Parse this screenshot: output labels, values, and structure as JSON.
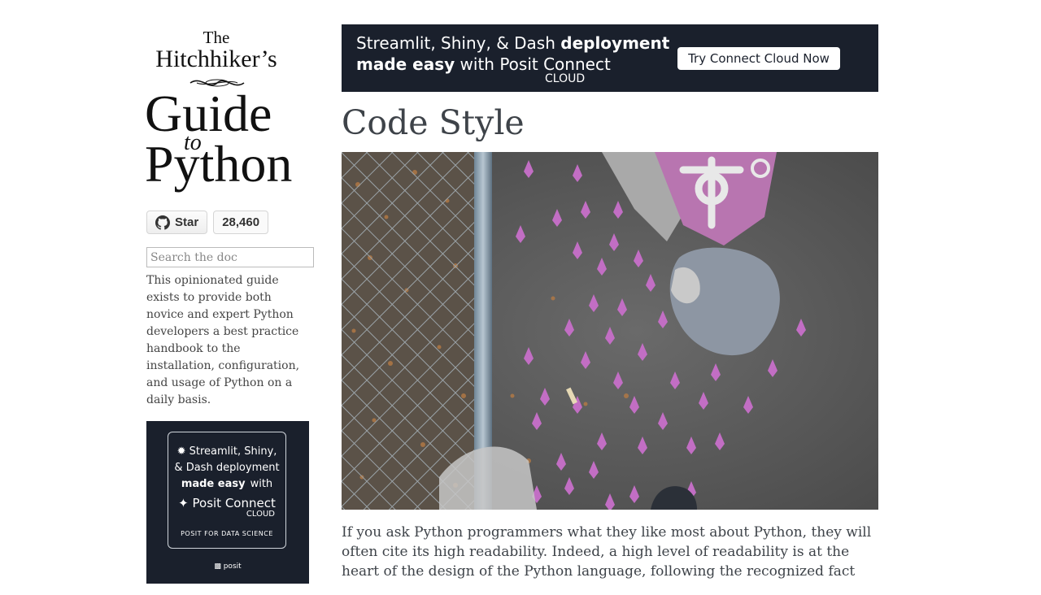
{
  "logo": {
    "the": "The",
    "hitchhikers": "Hitchhiker’s",
    "guide": "Guide",
    "to": "to",
    "python": "Python"
  },
  "github": {
    "star_label": "Star",
    "count": "28,460",
    "icon": "github-icon"
  },
  "search": {
    "placeholder": "Search the doc"
  },
  "sidebar_description": "This opinionated guide exists to provide both novice and expert Python developers a best practice handbook to the installation, configuration, and usage of Python on a daily basis.",
  "sidebar_ad": {
    "line1": "Streamlit, Shiny,",
    "line2": "& Dash deployment",
    "line3_bold": "made easy",
    "line3_rest": "with",
    "line4": "Posit Connect",
    "line5": "CLOUD",
    "line6": "POSIT FOR DATA SCIENCE",
    "brand": "posit"
  },
  "top_ad": {
    "line1_plain": "Streamlit, Shiny, & Dash ",
    "line1_bold": "deployment",
    "line2_bold": "made easy",
    "line2_plain": " with Posit Connect",
    "line3": "CLOUD",
    "cta": "Try Connect Cloud Now"
  },
  "page_title": "Code Style",
  "intro_paragraph": "If you ask Python programmers what they like most about Python, they will often cite its high readability. Indeed, a high level of readability is at the heart of the design of the Python language, following the recognized fact",
  "colors": {
    "ad_bg": "#1a202c",
    "text": "#3e4349",
    "petal": "#c070c0",
    "asphalt": "#5a5a5a"
  }
}
